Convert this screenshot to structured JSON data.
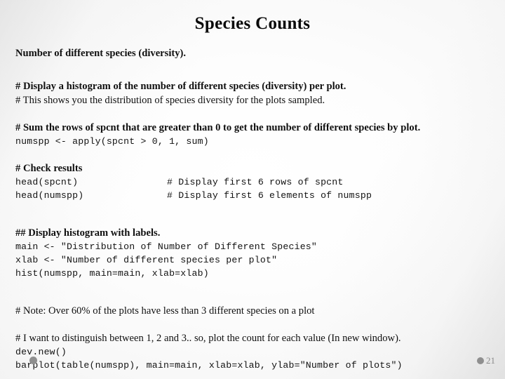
{
  "slide": {
    "title": "Species Counts",
    "subtitle": "Number of different species (diversity).",
    "blocks": {
      "comment_display_histogram": "# Display a histogram of the number of different species (diversity) per plot.",
      "comment_this_shows": "# This shows you the distribution of species diversity for the plots sampled.",
      "comment_sum_rows": "# Sum the rows of spcnt that are greater than 0 to get the number of different species by plot.",
      "code_numspp": "numspp <- apply(spcnt > 0, 1, sum)",
      "comment_check_results": "# Check results",
      "code_head_spcnt": "head(spcnt)",
      "comment_head_spcnt": "# Display first 6 rows of spcnt",
      "code_head_numspp": "head(numspp)",
      "comment_head_numspp": "# Display first 6 elements of numspp",
      "comment_display_labels": "## Display histogram with labels.",
      "code_main": "main <- \"Distribution of Number of Different Species\"",
      "code_xlab": "xlab <- \"Number of different species per plot\"",
      "code_hist": "hist(numspp, main=main, xlab=xlab)",
      "comment_note_60": "# Note: Over 60% of the plots have less than 3 different species on a plot",
      "comment_distinguish": "# I want to distinguish between 1, 2 and 3.. so, plot the count for each value (In new window).",
      "code_dev_new": "dev.new()",
      "code_barplot": "barplot(table(numspp), main=main, xlab=xlab, ylab=\"Number of plots\")"
    },
    "footer": {
      "page_number": "21"
    },
    "colors": {
      "text": "#101010",
      "title": "#0a0a0a",
      "footer_gray": "#8f8f8f",
      "page_number_gray": "#8a8a8a"
    }
  }
}
